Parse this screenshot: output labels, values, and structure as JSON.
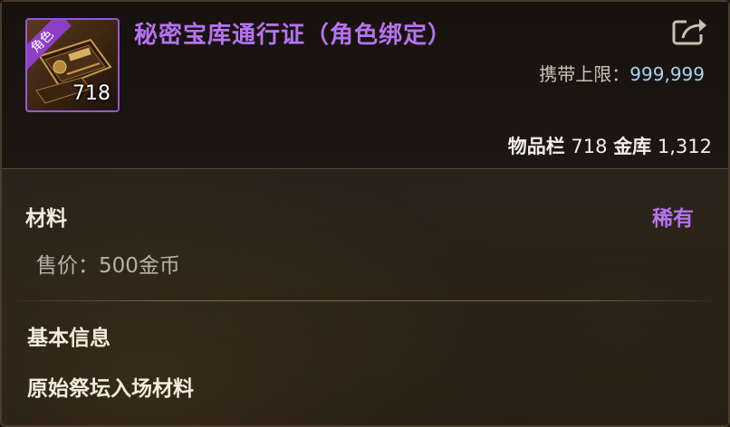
{
  "item": {
    "name": "秘密宝库通行证（角色绑定）",
    "icon": {
      "name": "treasure-pass-icon",
      "ribbon": "角色",
      "count": "718"
    },
    "carry_limit_label": "携带上限：",
    "carry_limit_value": "999,999",
    "inventory_label": "物品栏",
    "inventory_count": "718",
    "vault_label": "金库",
    "vault_count": "1,312"
  },
  "category": {
    "type": "材料",
    "rarity": "稀有",
    "price_label": "售价：",
    "price_value": "500金币"
  },
  "basic_info": {
    "heading": "基本信息",
    "description": "原始祭坛入场材料"
  },
  "colors": {
    "rarity": "#b673f0",
    "frame": "#9a55d8",
    "value": "#a9d3f2"
  },
  "share_icon": "share-export-icon"
}
